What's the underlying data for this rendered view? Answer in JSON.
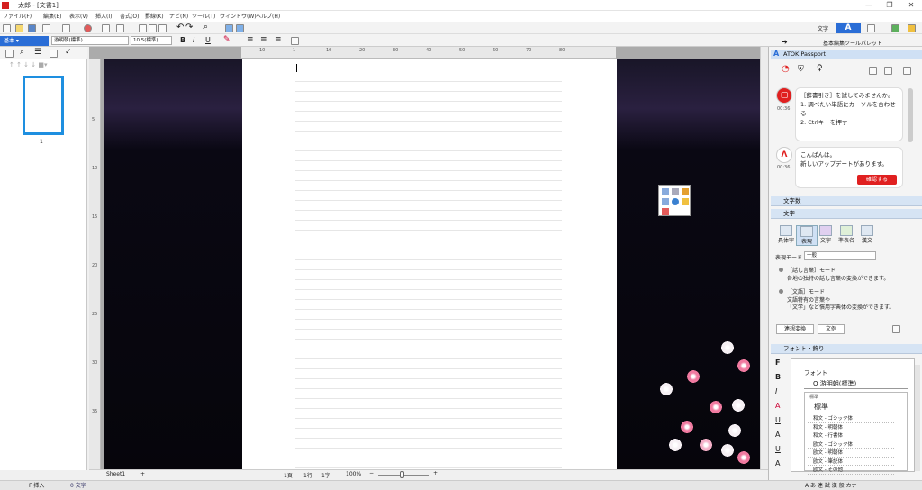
{
  "window": {
    "title": "一太郎 - [文書1]"
  },
  "menu": [
    "ファイル(F)",
    "編集(E)",
    "表示(V)",
    "挿入(I)",
    "書式(O)",
    "罫線(K)",
    "ナビ(N)",
    "ツール(T)",
    "ウィンドウ(W)",
    "ヘルプ(H)"
  ],
  "toolbar": {
    "style_label": "基本",
    "font_name": "游明朝(標準)",
    "font_size": "10.5(標準)",
    "bold": "B",
    "italic": "I",
    "underline": "U",
    "moji_label": "文字",
    "atok_logo": "A"
  },
  "left_panel": {
    "page_number": "1"
  },
  "ruler": {
    "top_ticks": [
      "10",
      "1",
      "10",
      "20",
      "30",
      "40",
      "50",
      "60",
      "70",
      "80"
    ],
    "left_ticks": [
      "5",
      "10",
      "15",
      "20",
      "25",
      "30",
      "35"
    ]
  },
  "doc_status": {
    "sheet_tab": "Sheet1",
    "add_sheet": "+",
    "page": "1頁",
    "line": "1行",
    "column": "1字",
    "zoom": "100%",
    "zoom_minus": "−",
    "zoom_plus": "+"
  },
  "statusbar": {
    "mode": "F 挿入",
    "char_count": "0 文字",
    "ime_indicator": "A あ 連 試 漢 般 カナ"
  },
  "right_panel": {
    "title": "基本編集ツールパレット",
    "atok_header": "ATOK Passport",
    "msg1": {
      "time": "00:36",
      "text": [
        "［辞書引き］を試してみませんか。",
        "1. 調べたい単語にカーソルを合わせる",
        "2. Ctrlキーを押す"
      ]
    },
    "msg2": {
      "time": "00:36",
      "text": [
        "こんばんは。",
        "新しいアップデートがあります。"
      ],
      "button": "確認する"
    },
    "char_count_header": "文字数",
    "moji_header": "文字",
    "categories": [
      "具体字",
      "表現",
      "文字",
      "準表名",
      "漢文"
    ],
    "expression_mode_label": "表現モード",
    "expression_mode_value": "一般",
    "mode1_title": "［話し言葉］モード",
    "mode1_desc": "各地の独特の話し言葉の変換ができます。",
    "mode2_title": "［文語］モード",
    "mode2_desc": [
      "文語特有の言葉や",
      "「文学」など慣用字典体の変換ができます。"
    ],
    "btn_continuous": "連想変換",
    "btn_example": "文例",
    "font_header": "フォント・飾り",
    "font_label": "フォント",
    "font_current": "O 游明朝(標準)",
    "font_style_label": "標準",
    "font_style_value": "標準",
    "font_list": [
      "和文 - ゴシック体",
      "和文 - 明朝体",
      "和文 - 行書体",
      "欧文 - ゴシック体",
      "欧文 - 明朝体",
      "欧文 - 筆記体",
      "欧文 - その他"
    ],
    "side_icons": [
      "F",
      "B",
      "I",
      "A",
      "U",
      "A",
      "U",
      "A"
    ]
  },
  "colors": {
    "accent": "#2a6dd6",
    "atok_red": "#e02020",
    "panel_header": "#d6e4f4",
    "thumb_border": "#1e8fe0"
  }
}
